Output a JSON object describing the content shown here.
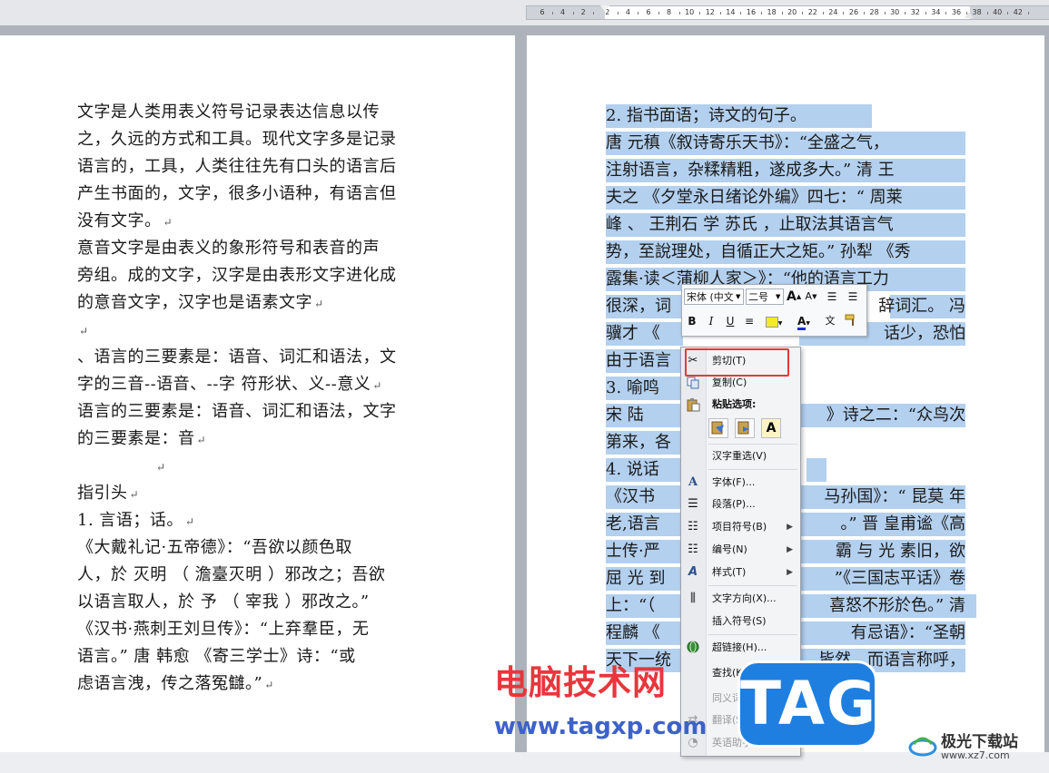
{
  "ruler": {
    "labels": [
      "6",
      "4",
      "2",
      "2",
      "4",
      "6",
      "8",
      "10",
      "12",
      "14",
      "16",
      "18",
      "20",
      "22",
      "24",
      "26",
      "28",
      "30",
      "32",
      "34",
      "36",
      "38",
      "40",
      "42"
    ]
  },
  "left_page": {
    "lines": [
      "文字是人类用表义符号记录表达信息以传",
      "之，久远的方式和工具。现代文字多是记录",
      "语言的，工具，人类往往先有口头的语言后",
      "产生书面的，文字，很多小语种，有语言但",
      "没有文字。",
      "意音文字是由表义的象形符号和表音的声",
      "旁组。成的文字，汉字是由表形文字进化成",
      "的意音文字，汉字也是语素文字",
      "",
      "、语言的三要素是：语音、词汇和语法，文",
      "字的三音--语音、--字  符形状、义--意义",
      "语言的三要素是：语音、词汇和语法，文字",
      "的三要素是：音",
      "",
      "指引头",
      "1.    言语；话。",
      "  《大戴礼记·五帝德》：“吾欲以颜色取",
      "人，於  灭明  （  澹臺灭明  ）邪改之；吾欲",
      "以语言取人，於  予  （  宰我  ）邪改之。”",
      "《汉书·燕刺王刘旦传》：“上弃羣臣，无",
      "语言。”  唐  韩愈  《寄三学士》诗：“或",
      "虑语言洩，传之落冤讎。”"
    ]
  },
  "right_page": {
    "lines": [
      "2.    指书面语；诗文的句子。",
      "  唐  元稹《叙诗寄乐天书》：“全盛之气，",
      "注射语言，杂糅精粗，遂成多大。”  清  王",
      "夫之  《夕堂永日绪论外编》四七：“  周莱",
      "峰  、  王荆石  学  苏氏  ，止取法其语言气",
      "势，至說理处，自循正大之矩。”  孙犁  《秀",
      "露集·读＜蒲柳人家＞》：“他的语言工力",
      "很深，词",
      "骥才  《",
      "由于语言",
      "3.    喻鸣",
      "  宋  陆",
      "第来，各",
      "4.    说话",
      "  《汉书",
      "老,语言",
      "士传·严",
      "屈  光  到",
      "上：“（",
      "程麟  《",
      "天下一统"
    ],
    "fragments": [
      "辞词汇。  冯",
      "话少，恐怕",
      "》诗之二：“众鸟次",
      "马孙国》：“  昆莫  年",
      "。”  晋  皇甫谧《高",
      "霸  与  光  素旧，欲",
      "”《三国志平话》卷",
      "喜怒不形於色。”  清",
      "有忌语》：“圣朝",
      "皆然。而语言称呼，"
    ]
  },
  "mini_toolbar": {
    "font_name": "宋体 (中文",
    "font_size": "二号",
    "bold": "B",
    "italic": "I",
    "underline": "U",
    "grow_font": "A",
    "shrink_font": "A",
    "font_color": "A",
    "phonetic": "文"
  },
  "context_menu": {
    "cut": "剪切(T)",
    "copy": "复制(C)",
    "paste_options": "粘贴选项:",
    "reconvert": "汉字重选(V)",
    "font": "字体(F)...",
    "paragraph": "段落(P)...",
    "bullets": "项目符号(B)",
    "numbering": "编号(N)",
    "styles": "样式(T)",
    "text_direction": "文字方向(X)...",
    "insert_symbol": "插入符号(S)",
    "hyperlink": "超链接(H)...",
    "lookup": "查找(K)",
    "synonyms": "同义词(Y)",
    "translate": "翻译(S)",
    "english_assistant": "英语助手(E)"
  },
  "watermark": {
    "site_name": "电脑技术网",
    "site_url": "www.tagxp.com",
    "logo_text": "TAG",
    "brand_name": "极光下载站",
    "brand_url": "www.xz7.com"
  },
  "colors": {
    "selection": "#b3d0ef",
    "highlight_box": "#e23b36",
    "watermark_red": "#e8363c",
    "watermark_blue": "#3d62c8",
    "tag_blue": "#1f7fe0"
  }
}
